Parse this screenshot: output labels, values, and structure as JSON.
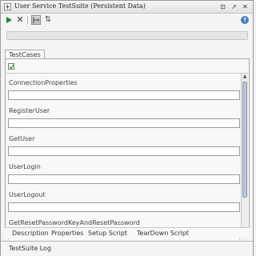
{
  "window": {
    "title": "User Service TestSuite (Persistent Data)",
    "title_icon": "plus-box-icon",
    "controls": {
      "restore": "⊡",
      "detach": "↗",
      "close": "✕"
    }
  },
  "toolbar": {
    "run_icon": "play-icon",
    "stop_glyph": "✕",
    "sort_glyph": "⇅",
    "help_glyph": "?"
  },
  "main_tab": {
    "label": "TestCases"
  },
  "testcases": [
    {
      "name": "ConnectionProperties",
      "value": ""
    },
    {
      "name": "RegisterUser",
      "value": ""
    },
    {
      "name": "GetUser",
      "value": ""
    },
    {
      "name": "UserLogin",
      "value": ""
    },
    {
      "name": "UserLogout",
      "value": ""
    },
    {
      "name": "GetResetPasswordKeyAndResetPassword",
      "value": ""
    }
  ],
  "bottom_tabs": [
    {
      "label": "Description"
    },
    {
      "label": "Properties"
    },
    {
      "label": "Setup Script"
    },
    {
      "label": "TearDown Script"
    }
  ],
  "log": {
    "label": "TestSuite Log"
  },
  "colors": {
    "run_green": "#1f8a2e",
    "help_blue": "#4a7bc4",
    "check_green": "#2a9a2a"
  }
}
